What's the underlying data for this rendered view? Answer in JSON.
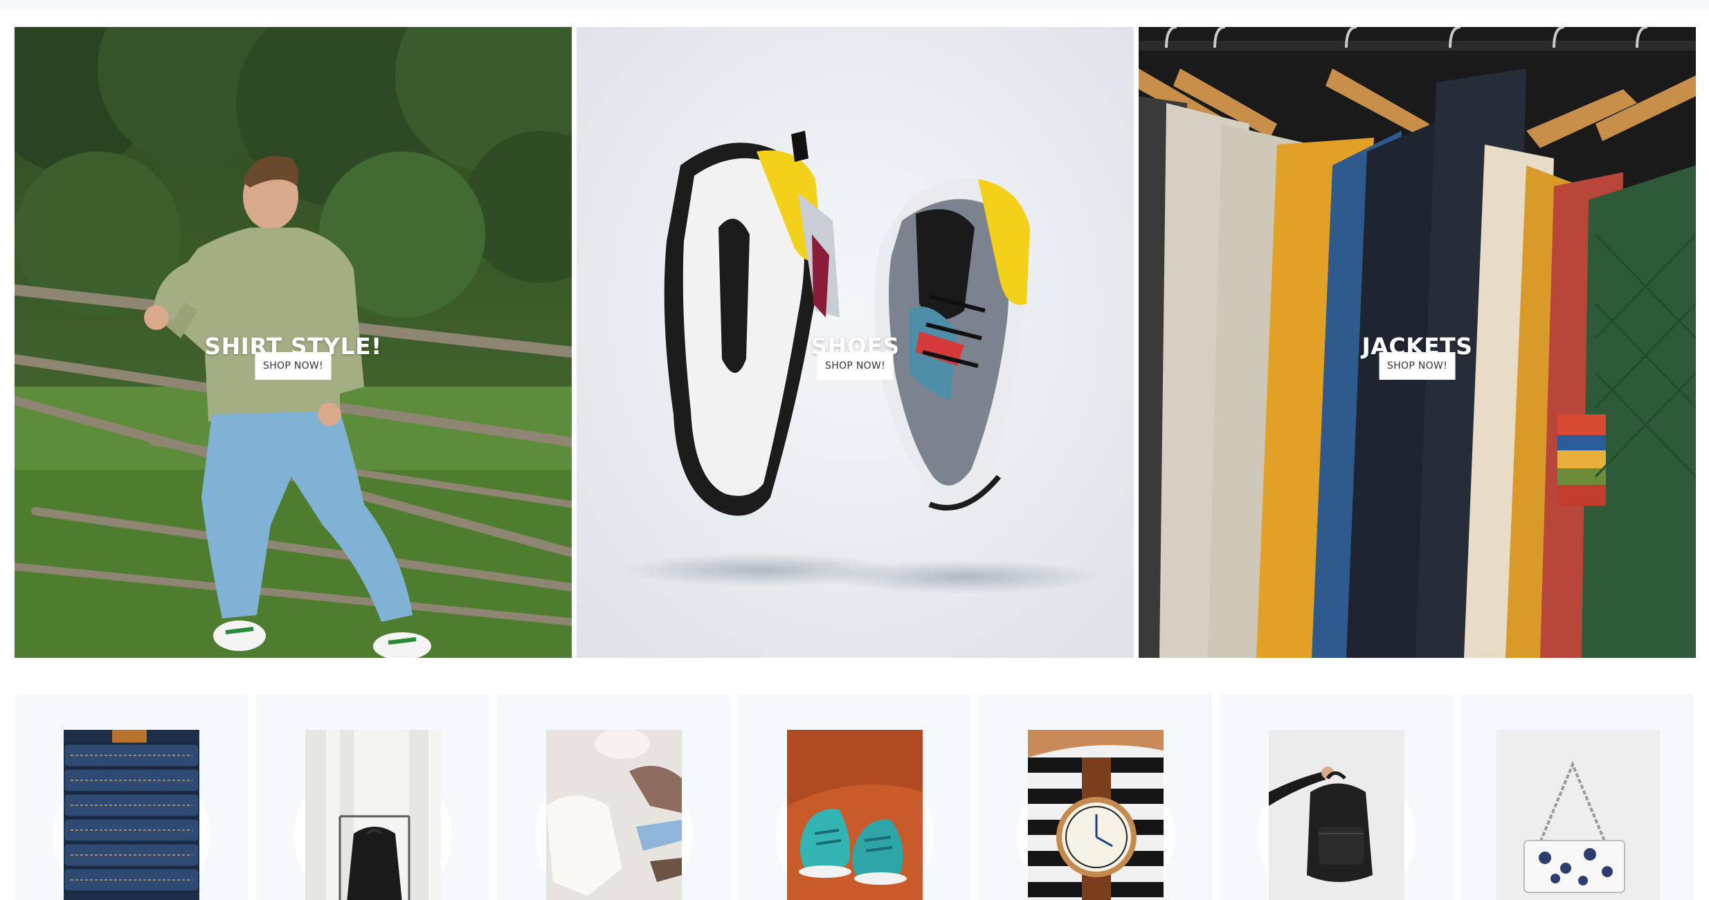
{
  "banners": [
    {
      "title": "SHIRT STYLE!",
      "button": "SHOP NOW!",
      "image": "man-in-green-shirt-photo"
    },
    {
      "title": "SHOES",
      "button": "SHOP NOW!",
      "image": "sneakers-photo"
    },
    {
      "title": "JACKETS",
      "button": "SHOP NOW!",
      "image": "jackets-rack-photo"
    }
  ],
  "categories": [
    {
      "image": "jeans-stack-photo"
    },
    {
      "image": "clothes-rack-photo"
    },
    {
      "image": "baby-clothes-photo"
    },
    {
      "image": "kids-shoes-photo"
    },
    {
      "image": "wrist-watch-photo"
    },
    {
      "image": "backpack-photo"
    },
    {
      "image": "handbag-photo"
    }
  ],
  "colors": {
    "button_bg": "#ffffff",
    "card_bg": "#f5f9fc",
    "banner_title": "#ffffff"
  }
}
